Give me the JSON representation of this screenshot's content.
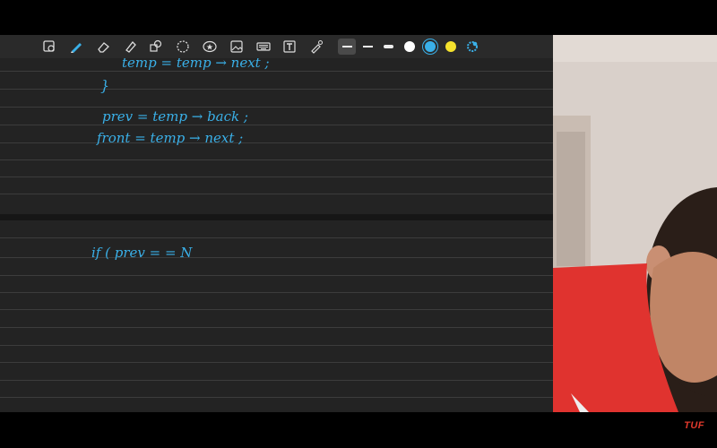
{
  "app": {
    "toolbar": {
      "tools": [
        "select-lasso-icon",
        "pen-icon",
        "eraser-icon",
        "highlighter-icon",
        "shapes-icon",
        "lasso-icon",
        "sticker-icon",
        "image-icon",
        "keyboard-icon",
        "text-box-icon",
        "laser-pointer-icon"
      ],
      "active_tool": "pen-icon",
      "pen_sizes": [
        "thin",
        "medium",
        "thick"
      ],
      "active_pen_size": "thin",
      "colors": [
        {
          "name": "white",
          "hex": "#ffffff"
        },
        {
          "name": "blue",
          "hex": "#3ab0e8"
        },
        {
          "name": "yellow",
          "hex": "#f5e22d"
        }
      ],
      "active_color": "blue"
    },
    "notes": {
      "ink_color": "#3ab0e8",
      "background": "#232323",
      "code_lines": [
        "temp = temp → next ;",
        "}",
        "prev  =  temp → back ;",
        "front =  temp  → next ;",
        "if  ( prev = = N"
      ]
    },
    "watermark": "TUF"
  }
}
